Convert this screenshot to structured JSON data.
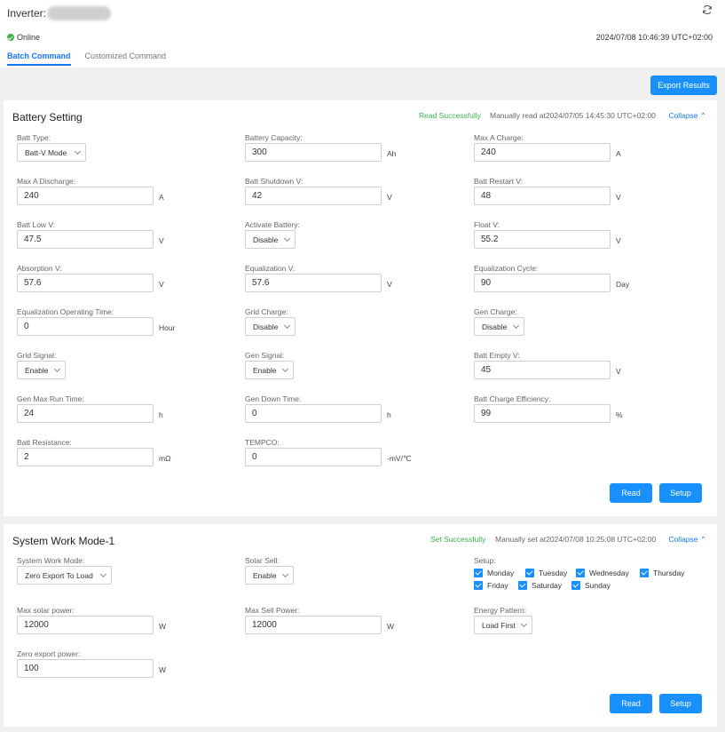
{
  "header": {
    "title": "Inverter:",
    "status": "Online",
    "timestamp": "2024/07/08 10:46:39 UTC+02:00",
    "tabs": [
      {
        "label": "Batch Command",
        "active": true
      },
      {
        "label": "Customized Command",
        "active": false
      }
    ]
  },
  "export_button": "Export Results",
  "battery": {
    "title": "Battery Setting",
    "status": "Read Successfully",
    "manual": "Manually read at2024/07/05 14:45:30 UTC+02:00",
    "collapse": "Collapse",
    "read": "Read",
    "setup": "Setup",
    "fields": {
      "batt_type": {
        "label": "Batt Type:",
        "value": "Batt-V Mode"
      },
      "battery_capacity": {
        "label": "Battery Capacity:",
        "value": "300",
        "unit": "Ah"
      },
      "max_a_charge": {
        "label": "Max A Charge:",
        "value": "240",
        "unit": "A"
      },
      "max_a_discharge": {
        "label": "Max A Discharge:",
        "value": "240",
        "unit": "A"
      },
      "batt_shutdown_v": {
        "label": "Batt Shutdown V:",
        "value": "42",
        "unit": "V"
      },
      "batt_restart_v": {
        "label": "Batt Restart V:",
        "value": "48",
        "unit": "V"
      },
      "batt_low_v": {
        "label": "Batt Low V:",
        "value": "47.5",
        "unit": "V"
      },
      "activate_battery": {
        "label": "Activate Battery:",
        "value": "Disable"
      },
      "float_v": {
        "label": "Float V:",
        "value": "55.2",
        "unit": "V"
      },
      "absorption_v": {
        "label": "Absorption  V:",
        "value": "57.6",
        "unit": "V"
      },
      "equalization_v": {
        "label": "Equalization V:",
        "value": "57.6",
        "unit": "V"
      },
      "equalization_cycle": {
        "label": "Equalization Cycle:",
        "value": "90",
        "unit": "Day"
      },
      "eq_operating_time": {
        "label": "Equalization Operating Time:",
        "value": "0",
        "unit": "Hour"
      },
      "grid_charge": {
        "label": "Grid Charge:",
        "value": "Disable"
      },
      "gen_charge": {
        "label": "Gen Charge:",
        "value": "Disable"
      },
      "grid_signal": {
        "label": "Grid Signal:",
        "value": "Enable"
      },
      "gen_signal": {
        "label": "Gen Signal:",
        "value": "Enable"
      },
      "batt_empty_v": {
        "label": "Batt Empty V:",
        "value": "45",
        "unit": "V"
      },
      "gen_max_run_time": {
        "label": "Gen Max Run Time:",
        "value": "24",
        "unit": "h"
      },
      "gen_down_time": {
        "label": "Gen Down Time:",
        "value": "0",
        "unit": "h"
      },
      "batt_charge_efficiency": {
        "label": "Batt Charge Efficiency:",
        "value": "99",
        "unit": "%"
      },
      "batt_resistance": {
        "label": "Batt Resistance:",
        "value": "2",
        "unit": "mΩ"
      },
      "tempco": {
        "label": "TEMPCO:",
        "value": "0",
        "unit": "-mV/℃"
      }
    }
  },
  "work_mode": {
    "title": "System Work Mode-1",
    "status": "Set Successfully",
    "manual": "Manually set at2024/07/08 10:25:08 UTC+02:00",
    "collapse": "Collapse",
    "read": "Read",
    "setup": "Setup",
    "fields": {
      "system_work_mode": {
        "label": "System Work Mode:",
        "value": "Zero Export To Load"
      },
      "solar_sell": {
        "label": "Solar Sell:",
        "value": "Enable"
      },
      "setup_label": "Setup:",
      "max_solar_power": {
        "label": "Max solar power:",
        "value": "12000",
        "unit": "W"
      },
      "max_sell_power": {
        "label": "Max Sell Power:",
        "value": "12000",
        "unit": "W"
      },
      "energy_pattern": {
        "label": "Energy Pattern:",
        "value": "Load First"
      },
      "zero_export_power": {
        "label": "Zero export power:",
        "value": "100",
        "unit": "W"
      }
    },
    "days": [
      {
        "label": "Monday",
        "checked": true
      },
      {
        "label": "Tuesday",
        "checked": true
      },
      {
        "label": "Wednesday",
        "checked": true
      },
      {
        "label": "Thursday",
        "checked": true
      },
      {
        "label": "Friday",
        "checked": true
      },
      {
        "label": "Saturday",
        "checked": true
      },
      {
        "label": "Sunday",
        "checked": true
      }
    ]
  }
}
